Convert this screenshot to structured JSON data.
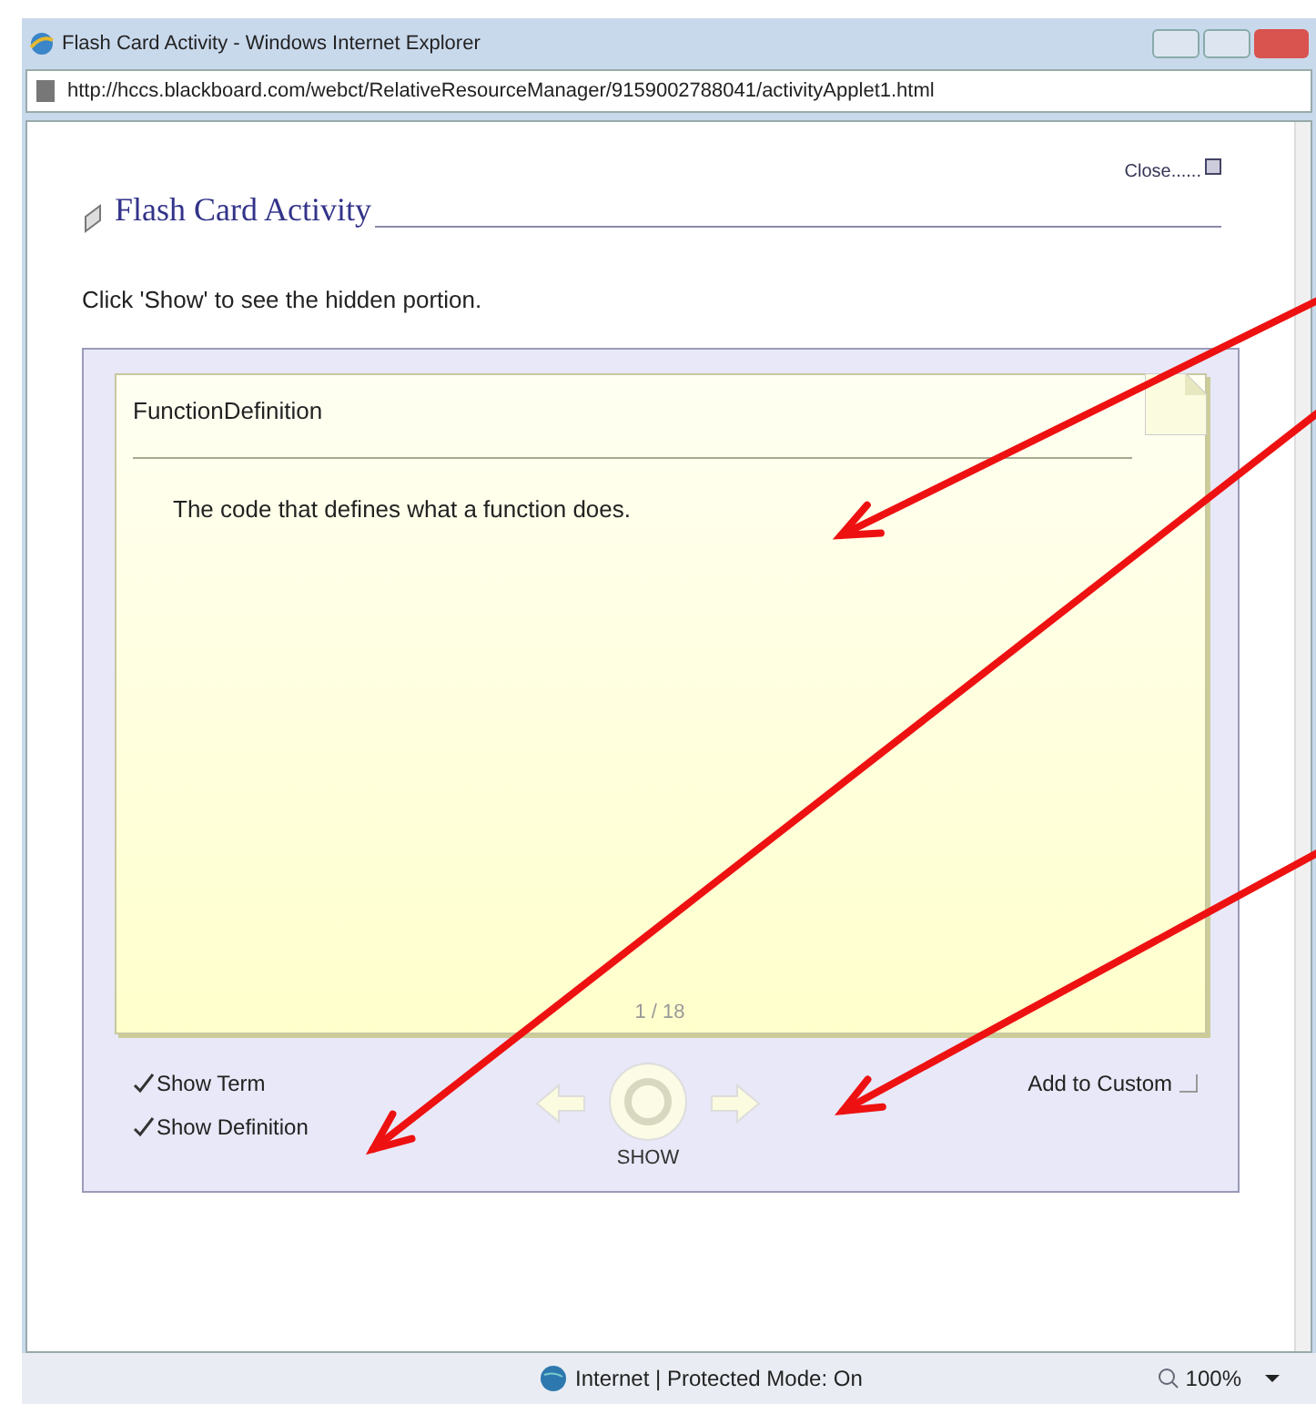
{
  "window": {
    "title": "Flash Card Activity - Windows Internet Explorer"
  },
  "address_bar": {
    "url": "http://hccs.blackboard.com/webct/RelativeResourceManager/9159002788041/activityApplet1.html"
  },
  "page": {
    "close_link": "Close......",
    "title": "Flash Card Activity",
    "instruction": "Click 'Show' to see the hidden portion."
  },
  "card": {
    "term": "FunctionDefinition",
    "definition": "The code that defines what a function does.",
    "counter": "1 / 18"
  },
  "options": [
    {
      "label": "Show Term",
      "checked": true
    },
    {
      "label": "Show Definition",
      "checked": true
    }
  ],
  "add_to_custom": {
    "label": "Add to Custom",
    "checked": false
  },
  "show_button": {
    "label": "SHOW"
  },
  "status_bar": {
    "zone": "Internet | Protected Mode: On",
    "zoom": "100%"
  }
}
